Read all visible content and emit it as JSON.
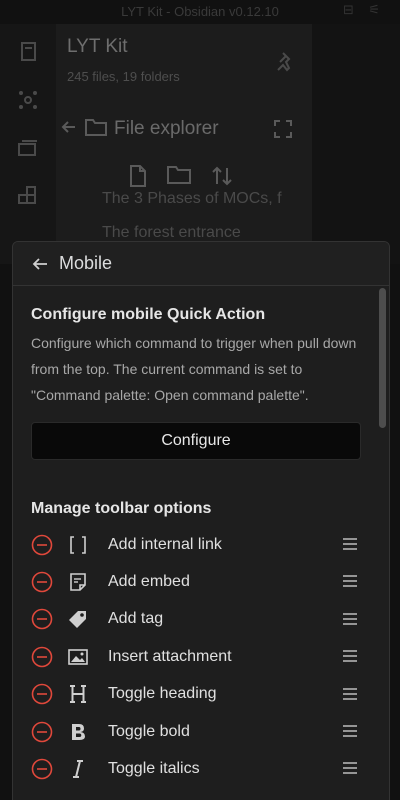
{
  "window": {
    "title": "LYT Kit - Obsidian v0.12.10"
  },
  "background": {
    "vault_name": "LYT Kit",
    "vault_stats": "245 files, 19 folders",
    "explorer_title": "File explorer",
    "files": [
      "The 3 Phases of MOCs, f",
      "The forest entrance"
    ]
  },
  "modal": {
    "header_title": "Mobile",
    "quick_action": {
      "heading": "Configure mobile Quick Action",
      "description": "Configure which command to trigger when pull down from the top. The current command is set to \"Command palette: Open command palette\".",
      "button_label": "Configure"
    },
    "toolbar": {
      "heading": "Manage toolbar options",
      "items": [
        {
          "label": "Add internal link",
          "icon": "brackets-icon"
        },
        {
          "label": "Add embed",
          "icon": "embed-icon"
        },
        {
          "label": "Add tag",
          "icon": "tag-icon"
        },
        {
          "label": "Insert attachment",
          "icon": "image-icon"
        },
        {
          "label": "Toggle heading",
          "icon": "heading-icon"
        },
        {
          "label": "Toggle bold",
          "icon": "bold-icon"
        },
        {
          "label": "Toggle italics",
          "icon": "italic-icon"
        }
      ]
    }
  },
  "colors": {
    "remove_red": "#e0483b",
    "sheet_bg": "#1e1e1e",
    "button_bg": "#090909"
  }
}
